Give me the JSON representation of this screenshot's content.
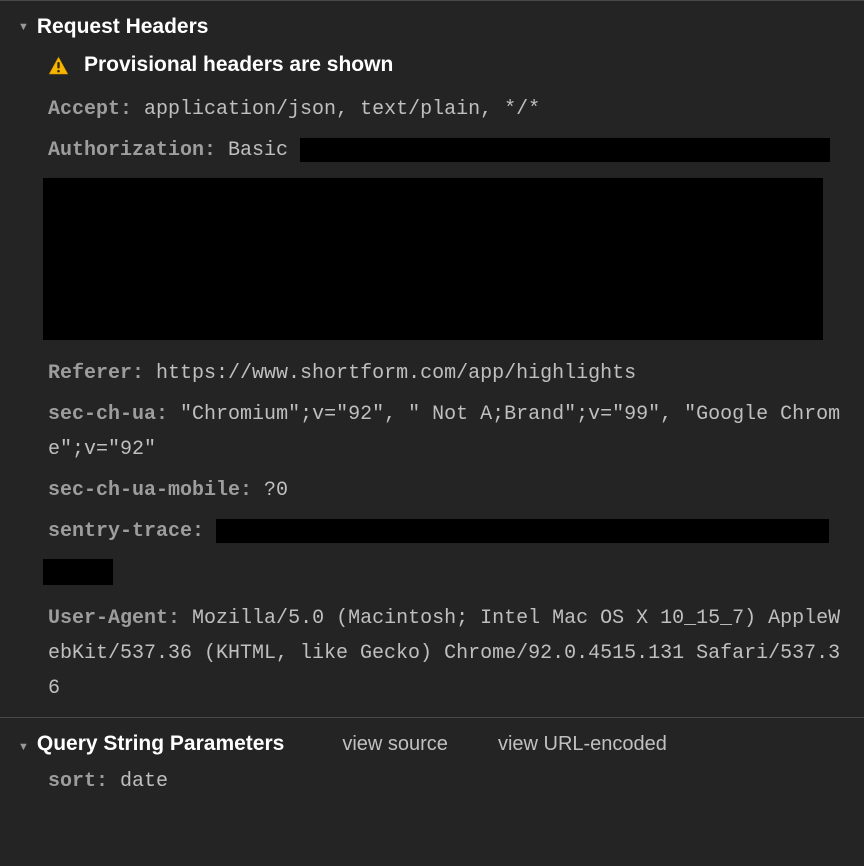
{
  "sections": {
    "request_headers": {
      "title": "Request Headers",
      "warning": "Provisional headers are shown"
    },
    "query_string_parameters": {
      "title": "Query String Parameters",
      "actions": {
        "view_source": "view source",
        "view_url_encoded": "view URL-encoded"
      }
    }
  },
  "headers": {
    "accept": {
      "name": "Accept",
      "value": "application/json, text/plain, */*"
    },
    "authorization": {
      "name": "Authorization",
      "value_prefix": "Basic "
    },
    "referer": {
      "name": "Referer",
      "value": "https://www.shortform.com/app/highlights"
    },
    "sec_ch_ua": {
      "name": "sec-ch-ua",
      "value": "\"Chromium\";v=\"92\", \" Not A;Brand\";v=\"99\", \"Google Chrome\";v=\"92\""
    },
    "sec_ch_ua_mobile": {
      "name": "sec-ch-ua-mobile",
      "value": "?0"
    },
    "sentry_trace": {
      "name": "sentry-trace"
    },
    "user_agent": {
      "name": "User-Agent",
      "value": "Mozilla/5.0 (Macintosh; Intel Mac OS X 10_15_7) AppleWebKit/537.36 (KHTML, like Gecko) Chrome/92.0.4515.131 Safari/537.36"
    }
  },
  "params": {
    "sort": {
      "name": "sort",
      "value": "date"
    }
  }
}
